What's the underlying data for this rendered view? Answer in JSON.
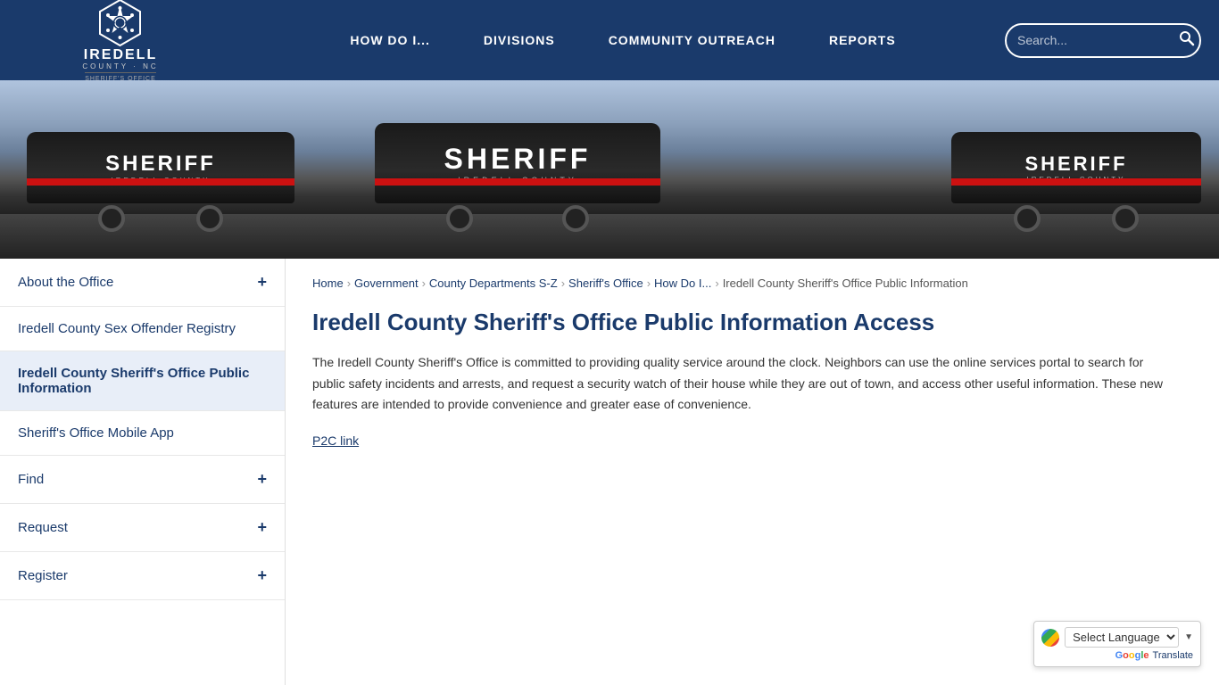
{
  "header": {
    "logo": {
      "title": "IREDELL",
      "subtitle": "COUNTY · NC",
      "office": "SHERIFF'S OFFICE"
    },
    "nav": {
      "items": [
        {
          "label": "HOW DO I...",
          "id": "how-do-i"
        },
        {
          "label": "DIVISIONS",
          "id": "divisions"
        },
        {
          "label": "COMMUNITY OUTREACH",
          "id": "community-outreach"
        },
        {
          "label": "REPORTS",
          "id": "reports"
        }
      ]
    },
    "search": {
      "placeholder": "Search..."
    }
  },
  "breadcrumb": {
    "items": [
      {
        "label": "Home",
        "href": "#"
      },
      {
        "label": "Government",
        "href": "#"
      },
      {
        "label": "County Departments S-Z",
        "href": "#"
      },
      {
        "label": "Sheriff's Office",
        "href": "#"
      },
      {
        "label": "How Do I...",
        "href": "#"
      }
    ],
    "current": "Iredell County Sheriff's Office Public Information"
  },
  "sidebar": {
    "items": [
      {
        "label": "About the Office",
        "has_plus": true,
        "active": false
      },
      {
        "label": "Iredell County Sex Offender Registry",
        "has_plus": false,
        "active": false
      },
      {
        "label": "Iredell County Sheriff's Office Public Information",
        "has_plus": false,
        "active": true
      },
      {
        "label": "Sheriff's Office Mobile App",
        "has_plus": false,
        "active": false
      },
      {
        "label": "Find",
        "has_plus": true,
        "active": false
      },
      {
        "label": "Request",
        "has_plus": true,
        "active": false
      },
      {
        "label": "Register",
        "has_plus": true,
        "active": false
      }
    ]
  },
  "content": {
    "title": "Iredell County Sheriff's Office Public Information Access",
    "description": "The Iredell County Sheriff's Office is committed to providing quality service around the clock. Neighbors can use the online services portal to search for public safety incidents and arrests, and request a security watch of their house while they are out of town, and access other useful information. These new features are intended to provide convenience and greater ease of convenience.",
    "link_label": "P2C link",
    "link_href": "#"
  },
  "translate": {
    "label": "Select Language",
    "translate_text": "Translate",
    "google_text": "Google"
  },
  "colors": {
    "primary": "#1a3a6b",
    "accent": "#cc1111",
    "light_bg": "#f5f5f5"
  }
}
